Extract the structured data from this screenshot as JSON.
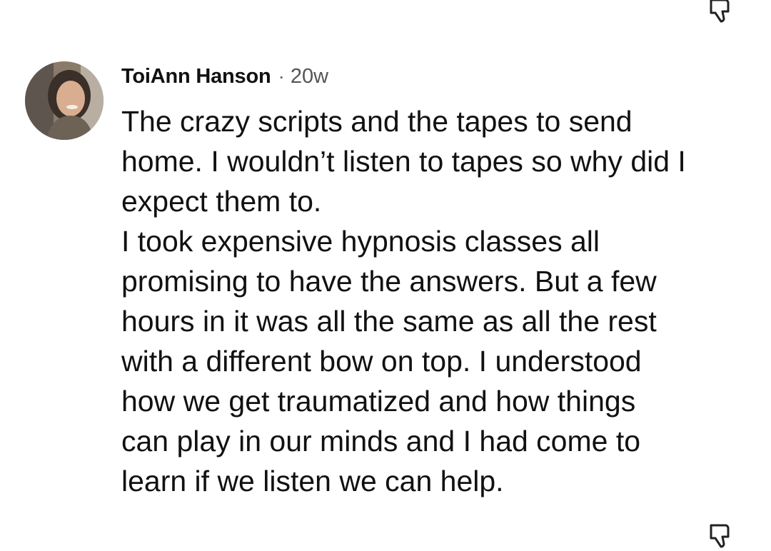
{
  "comment": {
    "author": "ToiAnn Hanson",
    "separator": "·",
    "time": "20w",
    "lines": [
      "The crazy scripts and the tapes to send",
      "home. I wouldn’t listen to tapes so why did I",
      "expect them to.",
      "I took expensive hypnosis classes all",
      "promising to have the answers. But a few",
      "hours in it was all the same as all the rest",
      "with a different bow on top. I understood",
      "how we get traumatized and how things",
      "can play in our minds and I had come to",
      "learn if we listen we can help."
    ]
  },
  "icons": {
    "dislike_top": "thumbs-down-icon",
    "dislike_bottom": "thumbs-down-icon",
    "avatar": "user-avatar"
  },
  "colors": {
    "text": "#111111",
    "meta": "#555555",
    "icon_stroke": "#222222",
    "background": "#ffffff"
  }
}
